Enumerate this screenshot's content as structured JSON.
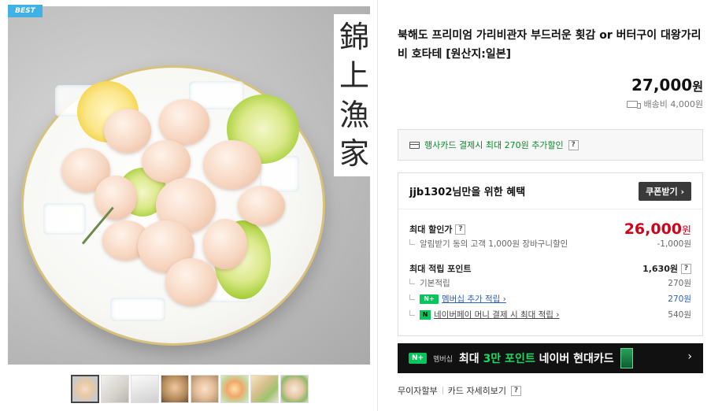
{
  "badge": "BEST",
  "image_calligraphy": [
    "錦",
    "上",
    "漁",
    "家"
  ],
  "thumbnails_count": 8,
  "product": {
    "title": "북해도 프리미엄 가리비관자 부드러운 횟감 or 버터구이 대왕가리비 호타테 [원산지:일본]",
    "price": "27,000",
    "price_unit": "원",
    "shipping": "배송비 4,000원"
  },
  "card_promo": {
    "text": "행사카드 결제시 최대 270원 추가할인",
    "help": "?"
  },
  "benefit": {
    "title": "jjb1302님만을 위한 혜택",
    "coupon_button": "쿠폰받기 ›",
    "max_discount_label": "최대 할인가",
    "max_discount_help": "?",
    "max_discount_price": "26,000",
    "max_discount_unit": "원",
    "alarm_label": "알림받기 동의 고객 1,000원 장바구니할인",
    "alarm_value": "-1,000원",
    "points_label": "최대 적립 포인트",
    "points_value": "1,630원",
    "points_help": "?",
    "base_label": "기본적립",
    "base_value": "270원",
    "membership_badge": "N+",
    "membership_label": "멤버십 추가 적립 ›",
    "membership_value": "270원",
    "npay_badge": "N",
    "npay_label": "네이버페이 머니 결제 시 최대 적립 ›",
    "npay_value": "540원"
  },
  "banner": {
    "badge": "N+",
    "badge_sub": "멤버십",
    "text_pre": "최대 ",
    "text_hl": "3만 포인트",
    "text_post": " 네이버 현대카드",
    "arrow": "›"
  },
  "bottom_links": {
    "installment": "무이자할부",
    "card_detail": "카드 자세히보기",
    "help": "?"
  }
}
